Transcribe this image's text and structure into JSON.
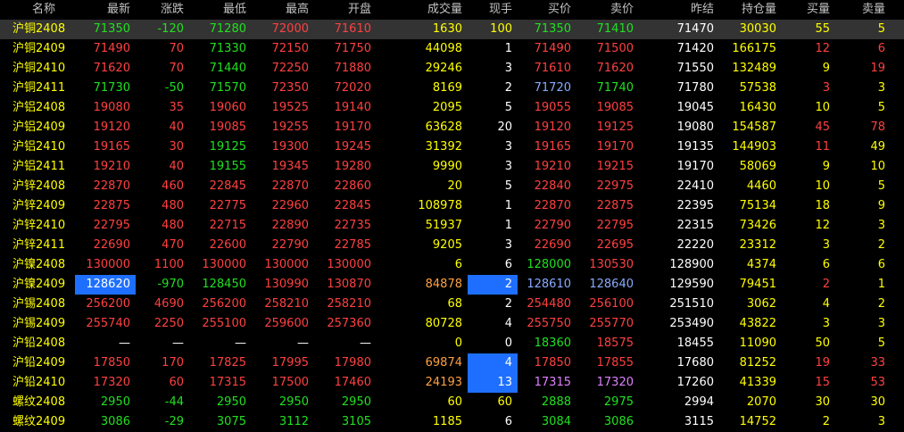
{
  "colors": {
    "header": "#c0c0c0",
    "name": "#ffff00",
    "up": "#ff4040",
    "down": "#20e020",
    "flat": "#ffffff",
    "volume": "#ffff00",
    "open_interest": "#ffff00",
    "bid_highlight_blue": "#88aaff",
    "bid_highlight_violet": "#e080ff",
    "selection_bg": "#333333",
    "highlight_bg": "#1e6fff"
  },
  "headers": [
    "名称",
    "最新",
    "涨跌",
    "最低",
    "最高",
    "开盘",
    "成交量",
    "现手",
    "买价",
    "卖价",
    "昨结",
    "持仓量",
    "买量",
    "卖量"
  ],
  "rows": [
    {
      "name": "沪铜2408",
      "last": "71350",
      "chg": "-120",
      "low": "71280",
      "high": "72000",
      "open": "71610",
      "vol": "1630",
      "cur": "100",
      "bid": "71350",
      "ask": "71410",
      "prev": "71470",
      "oi": "30030",
      "bidv": "55",
      "askv": "5",
      "sel": true,
      "c": {
        "last": "down",
        "chg": "down",
        "low": "down",
        "high": "up",
        "open": "up",
        "bid": "down",
        "ask": "down",
        "bidv": "name",
        "askv": "name",
        "cur": "name"
      }
    },
    {
      "name": "沪铜2409",
      "last": "71490",
      "chg": "70",
      "low": "71330",
      "high": "72150",
      "open": "71750",
      "vol": "44098",
      "cur": "1",
      "bid": "71490",
      "ask": "71500",
      "prev": "71420",
      "oi": "166175",
      "bidv": "12",
      "askv": "6",
      "c": {
        "last": "up",
        "chg": "up",
        "low": "down",
        "high": "up",
        "open": "up",
        "bid": "up",
        "ask": "up",
        "bidv": "up",
        "askv": "up",
        "cur": "flat"
      }
    },
    {
      "name": "沪铜2410",
      "last": "71620",
      "chg": "70",
      "low": "71440",
      "high": "72250",
      "open": "71880",
      "vol": "29246",
      "cur": "3",
      "bid": "71610",
      "ask": "71620",
      "prev": "71550",
      "oi": "132489",
      "bidv": "9",
      "askv": "19",
      "c": {
        "last": "up",
        "chg": "up",
        "low": "down",
        "high": "up",
        "open": "up",
        "bid": "up",
        "ask": "up",
        "bidv": "name",
        "askv": "up",
        "cur": "flat"
      }
    },
    {
      "name": "沪铜2411",
      "last": "71730",
      "chg": "-50",
      "low": "71570",
      "high": "72350",
      "open": "72020",
      "vol": "8169",
      "cur": "2",
      "bid": "71720",
      "ask": "71740",
      "prev": "71780",
      "oi": "57538",
      "bidv": "3",
      "askv": "3",
      "c": {
        "last": "down",
        "chg": "down",
        "low": "down",
        "high": "up",
        "open": "up",
        "bid": "blue",
        "ask": "down",
        "bidv": "up",
        "askv": "name",
        "cur": "flat"
      }
    },
    {
      "name": "沪铝2408",
      "last": "19080",
      "chg": "35",
      "low": "19060",
      "high": "19525",
      "open": "19140",
      "vol": "2095",
      "cur": "5",
      "bid": "19055",
      "ask": "19085",
      "prev": "19045",
      "oi": "16430",
      "bidv": "10",
      "askv": "5",
      "c": {
        "last": "up",
        "chg": "up",
        "low": "up",
        "high": "up",
        "open": "up",
        "bid": "up",
        "ask": "up",
        "bidv": "name",
        "askv": "name",
        "cur": "flat"
      }
    },
    {
      "name": "沪铝2409",
      "last": "19120",
      "chg": "40",
      "low": "19085",
      "high": "19255",
      "open": "19170",
      "vol": "63628",
      "cur": "20",
      "bid": "19120",
      "ask": "19125",
      "prev": "19080",
      "oi": "154587",
      "bidv": "45",
      "askv": "78",
      "c": {
        "last": "up",
        "chg": "up",
        "low": "up",
        "high": "up",
        "open": "up",
        "bid": "up",
        "ask": "up",
        "bidv": "up",
        "askv": "up",
        "cur": "flat"
      }
    },
    {
      "name": "沪铝2410",
      "last": "19165",
      "chg": "30",
      "low": "19125",
      "high": "19300",
      "open": "19245",
      "vol": "31392",
      "cur": "3",
      "bid": "19165",
      "ask": "19170",
      "prev": "19135",
      "oi": "144903",
      "bidv": "11",
      "askv": "49",
      "c": {
        "last": "up",
        "chg": "up",
        "low": "down",
        "high": "up",
        "open": "up",
        "bid": "up",
        "ask": "up",
        "bidv": "up",
        "askv": "name",
        "cur": "flat"
      }
    },
    {
      "name": "沪铝2411",
      "last": "19210",
      "chg": "40",
      "low": "19155",
      "high": "19345",
      "open": "19280",
      "vol": "9990",
      "cur": "3",
      "bid": "19210",
      "ask": "19215",
      "prev": "19170",
      "oi": "58069",
      "bidv": "9",
      "askv": "10",
      "c": {
        "last": "up",
        "chg": "up",
        "low": "down",
        "high": "up",
        "open": "up",
        "bid": "up",
        "ask": "up",
        "bidv": "name",
        "askv": "name",
        "cur": "flat"
      }
    },
    {
      "name": "沪锌2408",
      "last": "22870",
      "chg": "460",
      "low": "22845",
      "high": "22870",
      "open": "22860",
      "vol": "20",
      "cur": "5",
      "bid": "22840",
      "ask": "22975",
      "prev": "22410",
      "oi": "4460",
      "bidv": "10",
      "askv": "5",
      "c": {
        "last": "up",
        "chg": "up",
        "low": "up",
        "high": "up",
        "open": "up",
        "bid": "up",
        "ask": "up",
        "bidv": "name",
        "askv": "name",
        "cur": "flat"
      }
    },
    {
      "name": "沪锌2409",
      "last": "22875",
      "chg": "480",
      "low": "22775",
      "high": "22960",
      "open": "22845",
      "vol": "108978",
      "cur": "1",
      "bid": "22870",
      "ask": "22875",
      "prev": "22395",
      "oi": "75134",
      "bidv": "18",
      "askv": "9",
      "c": {
        "last": "up",
        "chg": "up",
        "low": "up",
        "high": "up",
        "open": "up",
        "bid": "up",
        "ask": "up",
        "bidv": "name",
        "askv": "name",
        "cur": "flat"
      }
    },
    {
      "name": "沪锌2410",
      "last": "22795",
      "chg": "480",
      "low": "22715",
      "high": "22890",
      "open": "22735",
      "vol": "51937",
      "cur": "1",
      "bid": "22790",
      "ask": "22795",
      "prev": "22315",
      "oi": "73426",
      "bidv": "12",
      "askv": "3",
      "c": {
        "last": "up",
        "chg": "up",
        "low": "up",
        "high": "up",
        "open": "up",
        "bid": "up",
        "ask": "up",
        "bidv": "name",
        "askv": "name",
        "cur": "flat"
      }
    },
    {
      "name": "沪锌2411",
      "last": "22690",
      "chg": "470",
      "low": "22600",
      "high": "22790",
      "open": "22785",
      "vol": "9205",
      "cur": "3",
      "bid": "22690",
      "ask": "22695",
      "prev": "22220",
      "oi": "23312",
      "bidv": "3",
      "askv": "2",
      "c": {
        "last": "up",
        "chg": "up",
        "low": "up",
        "high": "up",
        "open": "up",
        "bid": "up",
        "ask": "up",
        "bidv": "name",
        "askv": "name",
        "cur": "flat"
      }
    },
    {
      "name": "沪镍2408",
      "last": "130000",
      "chg": "1100",
      "low": "130000",
      "high": "130000",
      "open": "130000",
      "vol": "6",
      "cur": "6",
      "bid": "128000",
      "ask": "130530",
      "prev": "128900",
      "oi": "4374",
      "bidv": "6",
      "askv": "6",
      "c": {
        "last": "up",
        "chg": "up",
        "low": "up",
        "high": "up",
        "open": "up",
        "bid": "down",
        "ask": "up",
        "bidv": "name",
        "askv": "name",
        "cur": "flat"
      }
    },
    {
      "name": "沪镍2409",
      "last": "128620",
      "chg": "-970",
      "low": "128450",
      "high": "130990",
      "open": "130870",
      "vol": "84878",
      "cur": "2",
      "bid": "128610",
      "ask": "128640",
      "prev": "129590",
      "oi": "79451",
      "bidv": "2",
      "askv": "1",
      "c": {
        "last": "flat",
        "chg": "down",
        "low": "down",
        "high": "up",
        "open": "up",
        "bid": "blue",
        "ask": "blue",
        "bidv": "up",
        "askv": "name",
        "cur": "flat",
        "vol": "orange"
      },
      "hl": [
        "last",
        "cur"
      ]
    },
    {
      "name": "沪锡2408",
      "last": "256200",
      "chg": "4690",
      "low": "256200",
      "high": "258210",
      "open": "258210",
      "vol": "68",
      "cur": "2",
      "bid": "254480",
      "ask": "256100",
      "prev": "251510",
      "oi": "3062",
      "bidv": "4",
      "askv": "2",
      "c": {
        "last": "up",
        "chg": "up",
        "low": "up",
        "high": "up",
        "open": "up",
        "bid": "up",
        "ask": "up",
        "bidv": "name",
        "askv": "name",
        "cur": "flat"
      }
    },
    {
      "name": "沪锡2409",
      "last": "255740",
      "chg": "2250",
      "low": "255100",
      "high": "259600",
      "open": "257360",
      "vol": "80728",
      "cur": "4",
      "bid": "255750",
      "ask": "255770",
      "prev": "253490",
      "oi": "43822",
      "bidv": "3",
      "askv": "3",
      "c": {
        "last": "up",
        "chg": "up",
        "low": "up",
        "high": "up",
        "open": "up",
        "bid": "up",
        "ask": "up",
        "bidv": "name",
        "askv": "name",
        "cur": "flat"
      }
    },
    {
      "name": "沪铅2408",
      "last": "—",
      "chg": "—",
      "low": "—",
      "high": "—",
      "open": "—",
      "vol": "0",
      "cur": "0",
      "bid": "18360",
      "ask": "18575",
      "prev": "18455",
      "oi": "11090",
      "bidv": "50",
      "askv": "5",
      "c": {
        "last": "flat",
        "chg": "flat",
        "low": "flat",
        "high": "flat",
        "open": "flat",
        "bid": "down",
        "ask": "up",
        "bidv": "name",
        "askv": "name",
        "cur": "flat"
      }
    },
    {
      "name": "沪铅2409",
      "last": "17850",
      "chg": "170",
      "low": "17825",
      "high": "17995",
      "open": "17980",
      "vol": "69874",
      "cur": "4",
      "bid": "17850",
      "ask": "17855",
      "prev": "17680",
      "oi": "81252",
      "bidv": "19",
      "askv": "33",
      "c": {
        "last": "up",
        "chg": "up",
        "low": "up",
        "high": "up",
        "open": "up",
        "bid": "up",
        "ask": "up",
        "bidv": "up",
        "askv": "up",
        "cur": "flat",
        "vol": "orange"
      },
      "hl": [
        "cur"
      ]
    },
    {
      "name": "沪铅2410",
      "last": "17320",
      "chg": "60",
      "low": "17315",
      "high": "17500",
      "open": "17460",
      "vol": "24193",
      "cur": "13",
      "bid": "17315",
      "ask": "17320",
      "prev": "17260",
      "oi": "41339",
      "bidv": "15",
      "askv": "53",
      "c": {
        "last": "up",
        "chg": "up",
        "low": "up",
        "high": "up",
        "open": "up",
        "bid": "violet",
        "ask": "violet",
        "bidv": "up",
        "askv": "up",
        "cur": "flat",
        "vol": "orange"
      },
      "hl": [
        "cur"
      ]
    },
    {
      "name": "螺纹2408",
      "last": "2950",
      "chg": "-44",
      "low": "2950",
      "high": "2950",
      "open": "2950",
      "vol": "60",
      "cur": "60",
      "bid": "2888",
      "ask": "2975",
      "prev": "2994",
      "oi": "2070",
      "bidv": "30",
      "askv": "30",
      "c": {
        "last": "down",
        "chg": "down",
        "low": "down",
        "high": "down",
        "open": "down",
        "bid": "down",
        "ask": "down",
        "bidv": "name",
        "askv": "name",
        "cur": "name"
      }
    },
    {
      "name": "螺纹2409",
      "last": "3086",
      "chg": "-29",
      "low": "3075",
      "high": "3112",
      "open": "3105",
      "vol": "1185",
      "cur": "6",
      "bid": "3084",
      "ask": "3086",
      "prev": "3115",
      "oi": "14752",
      "bidv": "2",
      "askv": "3",
      "c": {
        "last": "down",
        "chg": "down",
        "low": "down",
        "high": "down",
        "open": "down",
        "bid": "down",
        "ask": "down",
        "bidv": "name",
        "askv": "name",
        "cur": "flat"
      }
    }
  ]
}
